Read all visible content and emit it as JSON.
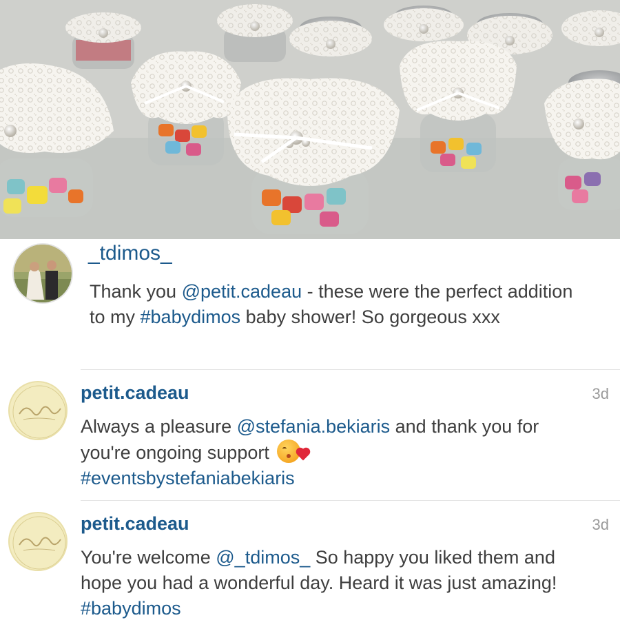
{
  "photo": {
    "description_icon": "candy-jars-photo"
  },
  "comments": [
    {
      "username": "_tdimos_",
      "time": "",
      "text_segments": [
        {
          "text": "Thank you ",
          "tag": false
        },
        {
          "text": "@petit.cadeau",
          "tag": true
        },
        {
          "text": " - these were the perfect addition to my ",
          "tag": false
        },
        {
          "text": "#babydimos",
          "tag": true
        },
        {
          "text": " baby shower! So gorgeous xxx",
          "tag": false
        }
      ]
    },
    {
      "username": "petit.cadeau",
      "time": "3d",
      "text_segments": [
        {
          "text": "Always a pleasure ",
          "tag": false
        },
        {
          "text": "@stefania.bekiaris",
          "tag": true
        },
        {
          "text": " and thank you for you're ongoing support ",
          "tag": false
        },
        {
          "text": "#eventsbystefaniabekiaris",
          "tag": true
        }
      ],
      "emoji": "kissing-face-emoji"
    },
    {
      "username": "petit.cadeau",
      "time": "3d",
      "text_segments": [
        {
          "text": "You're welcome ",
          "tag": false
        },
        {
          "text": "@_tdimos_",
          "tag": true
        },
        {
          "text": " So happy you liked them and hope you had a wonderful day. Heard it was just amazing! ",
          "tag": false
        },
        {
          "text": "#babydimos",
          "tag": true
        }
      ]
    }
  ],
  "colors": {
    "link": "#1c5a8c",
    "text": "#3e3e3e",
    "timestamp": "#9a9a9a",
    "logo_bg": "#f3ecc0"
  }
}
